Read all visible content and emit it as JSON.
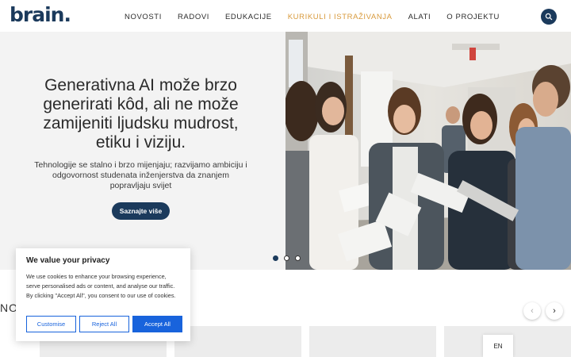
{
  "header": {
    "logo": "brain.",
    "nav": [
      {
        "label": "NOVOSTI",
        "active": false
      },
      {
        "label": "RADOVI",
        "active": false
      },
      {
        "label": "EDUKACIJE",
        "active": false
      },
      {
        "label": "KURIKULI I ISTRAŽIVANJA",
        "active": true
      },
      {
        "label": "ALATI",
        "active": false
      },
      {
        "label": "O PROJEKTU",
        "active": false
      }
    ],
    "search_icon": "search-icon"
  },
  "hero": {
    "title": "Generativna AI može brzo generirati kôd, ali ne može zamijeniti ljudsku mudrost, etiku i viziju.",
    "subtitle": "Tehnologije se stalno i brzo mijenjaju; razvijamo ambiciju i odgovornost studenata inženjerstva da znanjem popravljaju svijet",
    "button": "Saznajte više",
    "slides": 3,
    "active_slide": 1
  },
  "section": {
    "title": "NO"
  },
  "cookie": {
    "title": "We value your privacy",
    "text": "We use cookies to enhance your browsing experience, serve personalised ads or content, and analyse our traffic. By clicking \"Accept All\", you consent to our use of cookies.",
    "customise": "Customise",
    "reject": "Reject All",
    "accept": "Accept All"
  },
  "language": "EN",
  "colors": {
    "brand": "#1b3a5c",
    "accent": "#d89a3c",
    "cookie_blue": "#1863dc"
  }
}
